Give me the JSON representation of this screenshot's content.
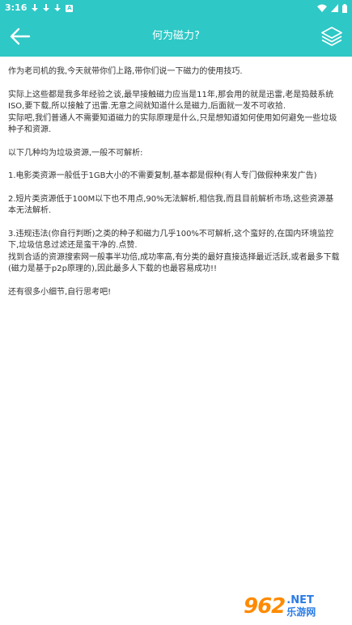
{
  "status_bar": {
    "time": "3:16",
    "a_badge": "A"
  },
  "app_bar": {
    "title": "何为磁力?"
  },
  "content": {
    "paragraphs": [
      "作为老司机的我,今天就带你们上路,带你们说一下磁力的使用技巧.",
      "实际上这些都是我多年经验之谈,最早接触磁力应当是11年,那会用的就是迅雷,老是捣鼓系统ISO,要下载,所以接触了迅雷.无意之间就知道什么是磁力,后面就一发不可收拾.",
      "实际吧,我们普通人不需要知道磁力的实际原理是什么,只是想知道如何使用如何避免一些垃圾种子和资源.",
      "以下几种均为垃圾资源,一般不可解析:",
      "1.电影类资源一般低于1GB大小的不需要复制,基本都是假种(有人专门做假种来发广告)",
      "2.短片类资源低于100M以下也不用点,90%无法解析,相信我,而且目前解析市场,这些资源基本无法解析.",
      "3.违规违法(你自行判断)之类的种子和磁力几乎100%不可解析,这个蛮好的,在国内环境监控下,垃圾信息过滤还是蛮干净的.点赞.",
      "找到合适的资源搜索网一般事半功倍,成功率高,有分类的最好直接选择最近活跃,或者最多下载(磁力是基于p2p原理的),因此最多人下载的也最容易成功!!",
      "还有很多小细节,自行思考吧!"
    ]
  },
  "watermark": {
    "number": "962",
    "domain": ".NET",
    "label": "乐游网"
  },
  "colors": {
    "accent": "#2ec8c6",
    "text": "#333333",
    "watermark_orange": "#ff8a00",
    "watermark_blue": "#2a7be4"
  },
  "icons": [
    "download-icon",
    "wifi-icon",
    "battery-icon",
    "back-arrow-icon",
    "layers-icon"
  ]
}
